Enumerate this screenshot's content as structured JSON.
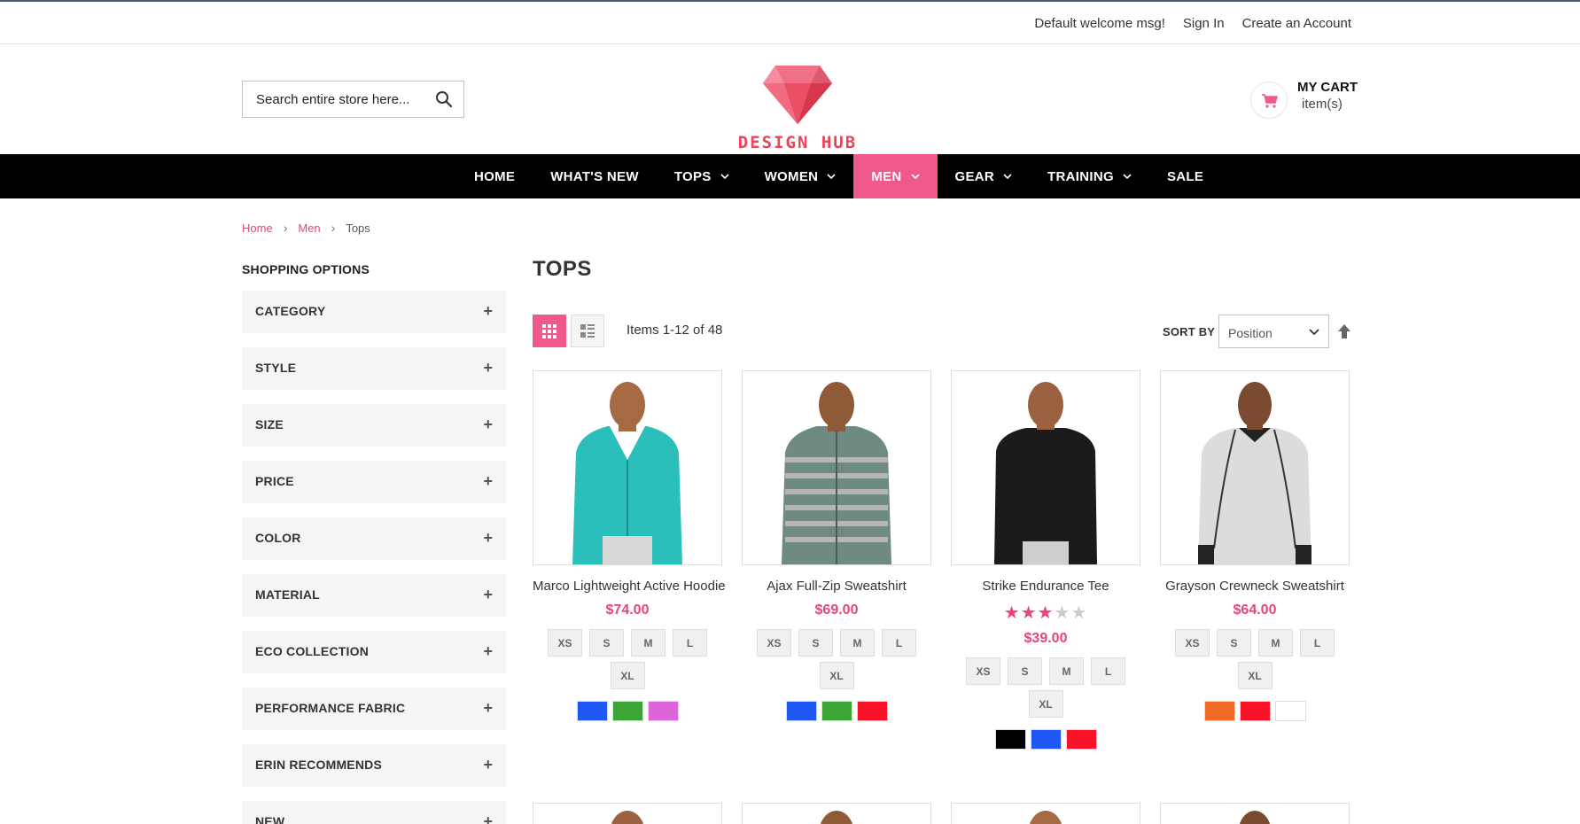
{
  "topbar": {
    "welcome": "Default welcome msg!",
    "sign_in": "Sign In",
    "create_account": "Create an Account"
  },
  "search": {
    "placeholder": "Search entire store here..."
  },
  "logo": {
    "text": "DESIGN HUB"
  },
  "cart": {
    "title": "MY CART",
    "items": "item(s)"
  },
  "nav": {
    "items": [
      {
        "label": "HOME"
      },
      {
        "label": "WHAT'S NEW"
      },
      {
        "label": "TOPS"
      },
      {
        "label": "WOMEN"
      },
      {
        "label": "MEN"
      },
      {
        "label": "GEAR"
      },
      {
        "label": "TRAINING"
      },
      {
        "label": "SALE"
      }
    ]
  },
  "breadcrumb": {
    "home": "Home",
    "men": "Men",
    "current": "Tops",
    "separator": "›"
  },
  "sidebar": {
    "heading": "SHOPPING OPTIONS",
    "filters": [
      "CATEGORY",
      "STYLE",
      "SIZE",
      "PRICE",
      "COLOR",
      "MATERIAL",
      "ECO COLLECTION",
      "PERFORMANCE FABRIC",
      "ERIN RECOMMENDS",
      "NEW"
    ],
    "plus": "+"
  },
  "main": {
    "title": "TOPS",
    "amount": "Items 1-12 of 48",
    "sort_label": "SORT BY",
    "sort_value": "Position"
  },
  "products": [
    {
      "name": "Marco Lightweight Active Hoodie",
      "price": "$74.00",
      "sizes": [
        "XS",
        "S",
        "M",
        "L",
        "XL"
      ],
      "colors": [
        "#1f57f5",
        "#3ba635",
        "#dd63da"
      ],
      "garment_color": "#2bbfbb"
    },
    {
      "name": "Ajax Full-Zip Sweatshirt",
      "price": "$69.00",
      "sizes": [
        "XS",
        "S",
        "M",
        "L",
        "XL"
      ],
      "colors": [
        "#1f57f5",
        "#3ba635",
        "#fa1227"
      ],
      "garment_color": "#6f8a82"
    },
    {
      "name": "Strike Endurance Tee",
      "price": "$39.00",
      "rating_stars": 3,
      "rating_max": 5,
      "sizes": [
        "XS",
        "S",
        "M",
        "L",
        "XL"
      ],
      "colors": [
        "#000000",
        "#1f57f5",
        "#fa1227"
      ],
      "garment_color": "#1c1a1c"
    },
    {
      "name": "Grayson Crewneck Sweatshirt",
      "price": "$64.00",
      "sizes": [
        "XS",
        "S",
        "M",
        "L",
        "XL"
      ],
      "colors": [
        "#ef6a25",
        "#fa1227",
        "#ffffff"
      ],
      "garment_color": "#dcdcda"
    }
  ],
  "accent_color": "#f05a8a"
}
